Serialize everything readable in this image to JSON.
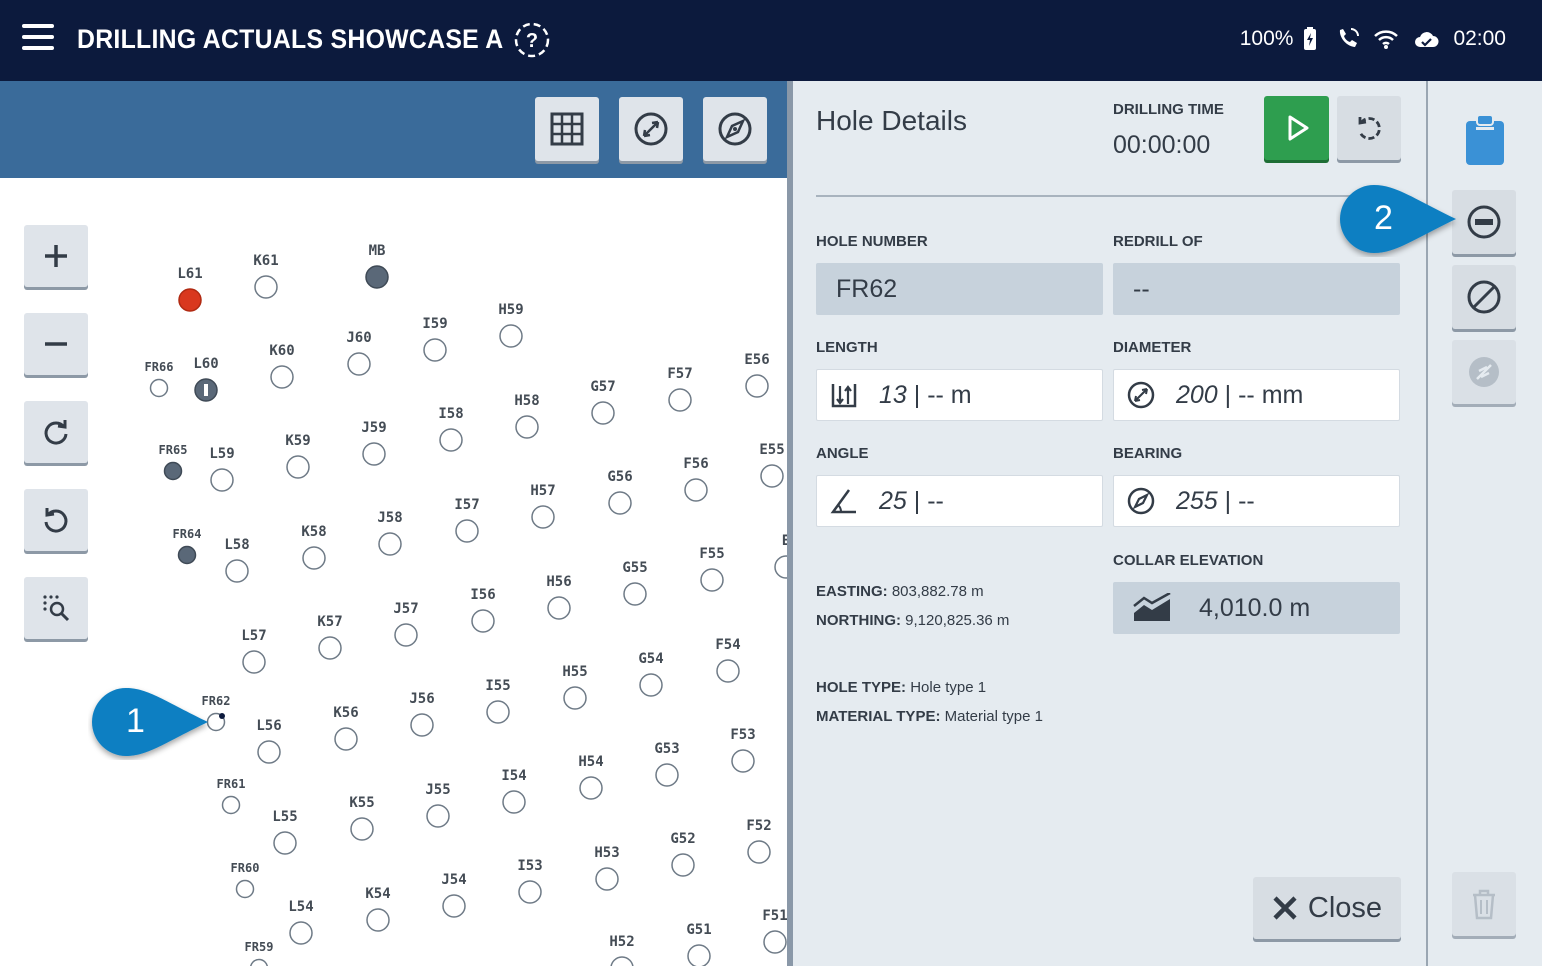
{
  "header": {
    "title": "DRILLING ACTUALS SHOWCASE A",
    "battery": "100%",
    "time": "02:00",
    "icons": [
      "menu-icon",
      "help-icon",
      "battery-charging-icon",
      "phone-icon",
      "wifi-icon",
      "cloud-sync-icon"
    ]
  },
  "map": {
    "toolbar_icons": [
      "table-icon",
      "diameter-icon",
      "bearing-icon"
    ],
    "zoom_icons": [
      "zoom-in-icon",
      "zoom-out-icon",
      "rotate-cw-icon",
      "rotate-ccw-icon",
      "zoom-selection-icon"
    ],
    "holes": [
      {
        "label": "L61",
        "state": "active"
      },
      {
        "label": "K61",
        "state": "empty"
      },
      {
        "label": "MB",
        "state": "filled"
      },
      {
        "label": "FR66",
        "state": "small"
      },
      {
        "label": "L60",
        "state": "filled-marked"
      },
      {
        "label": "K60",
        "state": "empty"
      },
      {
        "label": "J60",
        "state": "empty"
      },
      {
        "label": "I59",
        "state": "empty"
      },
      {
        "label": "H59",
        "state": "empty"
      },
      {
        "label": "FR65",
        "state": "filled-small"
      },
      {
        "label": "L59",
        "state": "empty"
      },
      {
        "label": "K59",
        "state": "empty"
      },
      {
        "label": "J59",
        "state": "empty"
      },
      {
        "label": "I58",
        "state": "empty"
      },
      {
        "label": "H58",
        "state": "empty"
      },
      {
        "label": "G57",
        "state": "empty"
      },
      {
        "label": "F57",
        "state": "empty"
      },
      {
        "label": "E56",
        "state": "empty"
      },
      {
        "label": "FR64",
        "state": "filled-small"
      },
      {
        "label": "L58",
        "state": "empty"
      },
      {
        "label": "K58",
        "state": "empty"
      },
      {
        "label": "J58",
        "state": "empty"
      },
      {
        "label": "I57",
        "state": "empty"
      },
      {
        "label": "H57",
        "state": "empty"
      },
      {
        "label": "G56",
        "state": "empty"
      },
      {
        "label": "F56",
        "state": "empty"
      },
      {
        "label": "E55",
        "state": "empty"
      },
      {
        "label": "L57",
        "state": "empty"
      },
      {
        "label": "K57",
        "state": "empty"
      },
      {
        "label": "J57",
        "state": "empty"
      },
      {
        "label": "I56",
        "state": "empty"
      },
      {
        "label": "H56",
        "state": "empty"
      },
      {
        "label": "G55",
        "state": "empty"
      },
      {
        "label": "F55",
        "state": "empty"
      },
      {
        "label": "E",
        "state": "empty"
      },
      {
        "label": "FR62",
        "state": "selected"
      },
      {
        "label": "L56",
        "state": "empty"
      },
      {
        "label": "K56",
        "state": "empty"
      },
      {
        "label": "J56",
        "state": "empty"
      },
      {
        "label": "I55",
        "state": "empty"
      },
      {
        "label": "H55",
        "state": "empty"
      },
      {
        "label": "G54",
        "state": "empty"
      },
      {
        "label": "F54",
        "state": "empty"
      },
      {
        "label": "FR61",
        "state": "small"
      },
      {
        "label": "L55",
        "state": "empty"
      },
      {
        "label": "K55",
        "state": "empty"
      },
      {
        "label": "J55",
        "state": "empty"
      },
      {
        "label": "I54",
        "state": "empty"
      },
      {
        "label": "H54",
        "state": "empty"
      },
      {
        "label": "G53",
        "state": "empty"
      },
      {
        "label": "F53",
        "state": "empty"
      },
      {
        "label": "FR60",
        "state": "small"
      },
      {
        "label": "L54",
        "state": "empty"
      },
      {
        "label": "K54",
        "state": "empty"
      },
      {
        "label": "J54",
        "state": "empty"
      },
      {
        "label": "I53",
        "state": "empty"
      },
      {
        "label": "H53",
        "state": "empty"
      },
      {
        "label": "G52",
        "state": "empty"
      },
      {
        "label": "F52",
        "state": "empty"
      },
      {
        "label": "FR59",
        "state": "small"
      },
      {
        "label": "H52",
        "state": "empty"
      },
      {
        "label": "G51",
        "state": "empty"
      },
      {
        "label": "F51",
        "state": "empty"
      }
    ]
  },
  "panel": {
    "title": "Hole Details",
    "drilling_time_label": "DRILLING TIME",
    "drilling_time": "00:00:00",
    "hole_number_label": "HOLE NUMBER",
    "hole_number": "FR62",
    "redrill_label": "REDRILL OF",
    "redrill": "--",
    "length_label": "LENGTH",
    "length_value": "13",
    "length_rest": " | -- m",
    "diameter_label": "DIAMETER",
    "diameter_value": "200",
    "diameter_rest": " | -- mm",
    "angle_label": "ANGLE",
    "angle_value": "25",
    "angle_rest": " | --",
    "bearing_label": "BEARING",
    "bearing_value": "255",
    "bearing_rest": " | --",
    "collar_label": "COLLAR ELEVATION",
    "collar_value": "4,010.0 m",
    "easting_label": "EASTING:",
    "easting": "803,882.78 m",
    "northing_label": "NORTHING:",
    "northing": "9,120,825.36 m",
    "hole_type_label": "HOLE TYPE:",
    "hole_type": "Hole type 1",
    "material_type_label": "MATERIAL TYPE:",
    "material_type": "Material type 1",
    "close_label": "Close"
  },
  "callouts": {
    "one": "1",
    "two": "2"
  },
  "colors": {
    "topbar": "#0c1a3d",
    "map_toolbar": "#3a6b9a",
    "panel": "#e5ebf0",
    "play": "#2e9e4f",
    "active_hole": "#d9381e",
    "filled_hole": "#5a6878",
    "callout": "#0b7fc2",
    "clipboard": "#3a91d6"
  }
}
